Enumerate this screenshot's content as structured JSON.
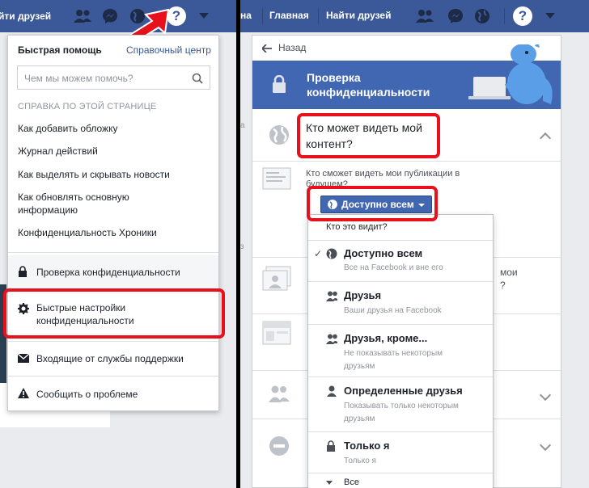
{
  "left": {
    "topbar": {
      "friends_link": "йти друзей"
    },
    "dropdown": {
      "quick_help": "Быстрая помощь",
      "help_center": "Справочный центр",
      "search_placeholder": "Чем мы можем помочь?",
      "section_title": "СПРАВКА ПО ЭТОЙ СТРАНИЦЕ",
      "articles": [
        "Как добавить обложку",
        "Журнал действий",
        "Как выделять и скрывать новости",
        "Как обновлять основную",
        "информацию",
        "Конфиденциальность Хроники"
      ],
      "privacy_check": "Проверка конфиденциальности",
      "quick_settings_line1": "Быстрые настройки",
      "quick_settings_line2": "конфиденциальности",
      "support_inbox": "Входящие от службы поддержки",
      "report_problem": "Сообщить о проблеме"
    }
  },
  "right": {
    "topbar": {
      "home": "Главная",
      "find_friends": "Найти друзей",
      "partial": "на"
    },
    "back": "Назад",
    "header_title_1": "Проверка",
    "header_title_2": "конфиденциальности",
    "content_q1": "Кто может видеть мой",
    "content_q2": "контент?",
    "future_posts_1": "Кто сможет видеть мои публикации в",
    "future_posts_2": "будущем?",
    "audience_button": "Доступно всем",
    "menu_header": "Кто это видит?",
    "options": [
      {
        "label": "Доступно всем",
        "sub1": "Все на Facebook и вне его",
        "sub2": ""
      },
      {
        "label": "Друзья",
        "sub1": "Ваши друзья на Facebook",
        "sub2": ""
      },
      {
        "label": "Друзья, кроме...",
        "sub1": "Не показывать некоторым",
        "sub2": "друзьям"
      },
      {
        "label": "Определенные друзья",
        "sub1": "Показывать только некоторым",
        "sub2": "друзьям"
      },
      {
        "label": "Только я",
        "sub1": "Только я",
        "sub2": ""
      },
      {
        "label": "Все",
        "sub1": "",
        "sub2": ""
      }
    ],
    "bg_text": {
      "moi": "мои",
      "q": "?"
    }
  },
  "colors": {
    "fb_blue": "#3b5998",
    "header_blue": "#4267b2",
    "highlight_red": "#e8101a"
  }
}
